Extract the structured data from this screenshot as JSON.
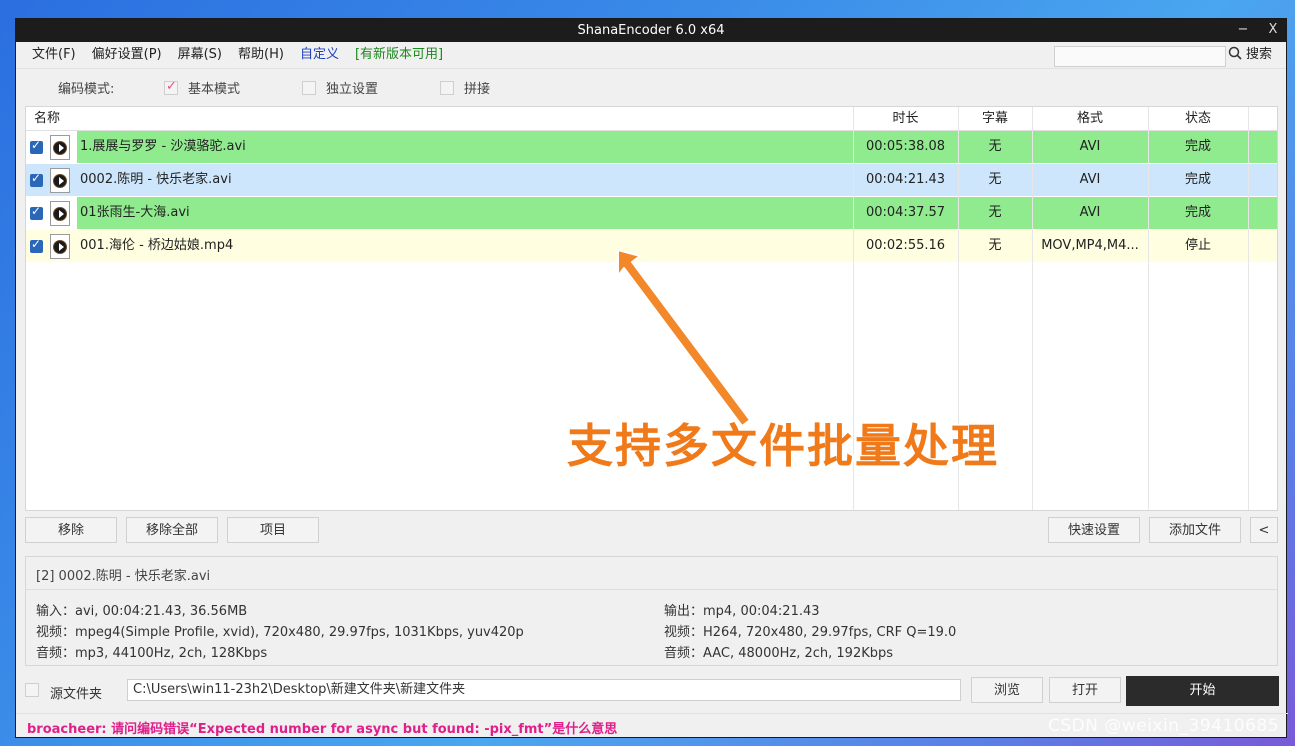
{
  "window": {
    "title": "ShanaEncoder 6.0 x64",
    "minimize": "−",
    "close": "X"
  },
  "menu": {
    "items": [
      "文件(F)",
      "偏好设置(P)",
      "屏幕(S)",
      "帮助(H)"
    ],
    "custom": "自定义",
    "update": "[有新版本可用]",
    "search_label": "搜索",
    "search_value": ""
  },
  "mode": {
    "label": "编码模式:",
    "options": [
      {
        "label": "基本模式",
        "checked": true
      },
      {
        "label": "独立设置",
        "checked": false
      },
      {
        "label": "拼接",
        "checked": false
      }
    ]
  },
  "list": {
    "headers": {
      "name": "名称",
      "duration": "时长",
      "subtitle": "字幕",
      "format": "格式",
      "status": "状态"
    },
    "rows": [
      {
        "name": "1.展展与罗罗 - 沙漠骆驼.avi",
        "duration": "00:05:38.08",
        "subtitle": "无",
        "format": "AVI",
        "status": "完成",
        "bg": "#90ea8e"
      },
      {
        "name": "0002.陈明 - 快乐老家.avi",
        "duration": "00:04:21.43",
        "subtitle": "无",
        "format": "AVI",
        "status": "完成",
        "bg": "#cde6fb"
      },
      {
        "name": "01张雨生-大海.avi",
        "duration": "00:04:37.57",
        "subtitle": "无",
        "format": "AVI",
        "status": "完成",
        "bg": "#90ea8e"
      },
      {
        "name": "001.海伦 - 桥边姑娘.mp4",
        "duration": "00:02:55.16",
        "subtitle": "无",
        "format": "MOV,MP4,M4...",
        "status": "停止",
        "bg": "#fffee0"
      }
    ]
  },
  "buttons": {
    "remove": "移除",
    "remove_all": "移除全部",
    "item": "项目",
    "quick_settings": "快速设置",
    "add_file": "添加文件",
    "collapse": "<"
  },
  "info": {
    "selected": "[2] 0002.陈明 - 快乐老家.avi",
    "input": "输入：avi, 00:04:21.43, 36.56MB",
    "input_video": "视频：mpeg4(Simple Profile, xvid), 720x480, 29.97fps, 1031Kbps,  yuv420p",
    "input_audio": "音频：mp3, 44100Hz, 2ch, 128Kbps",
    "output": "输出：mp4, 00:04:21.43",
    "output_video": "视频：H264, 720x480, 29.97fps, CRF Q=19.0",
    "output_audio": "音频：AAC, 48000Hz, 2ch, 192Kbps"
  },
  "output_bar": {
    "source_folder_label": "源文件夹",
    "path": "C:\\Users\\win11-23h2\\Desktop\\新建文件夹\\新建文件夹",
    "browse": "浏览",
    "open": "打开",
    "start": "开始"
  },
  "status_text": "broacheer: 请问编码错误“Expected number for async but found: -pix_fmt”是什么意思",
  "overlay": "支持多文件批量处理",
  "watermark": "CSDN @weixin_39410685"
}
